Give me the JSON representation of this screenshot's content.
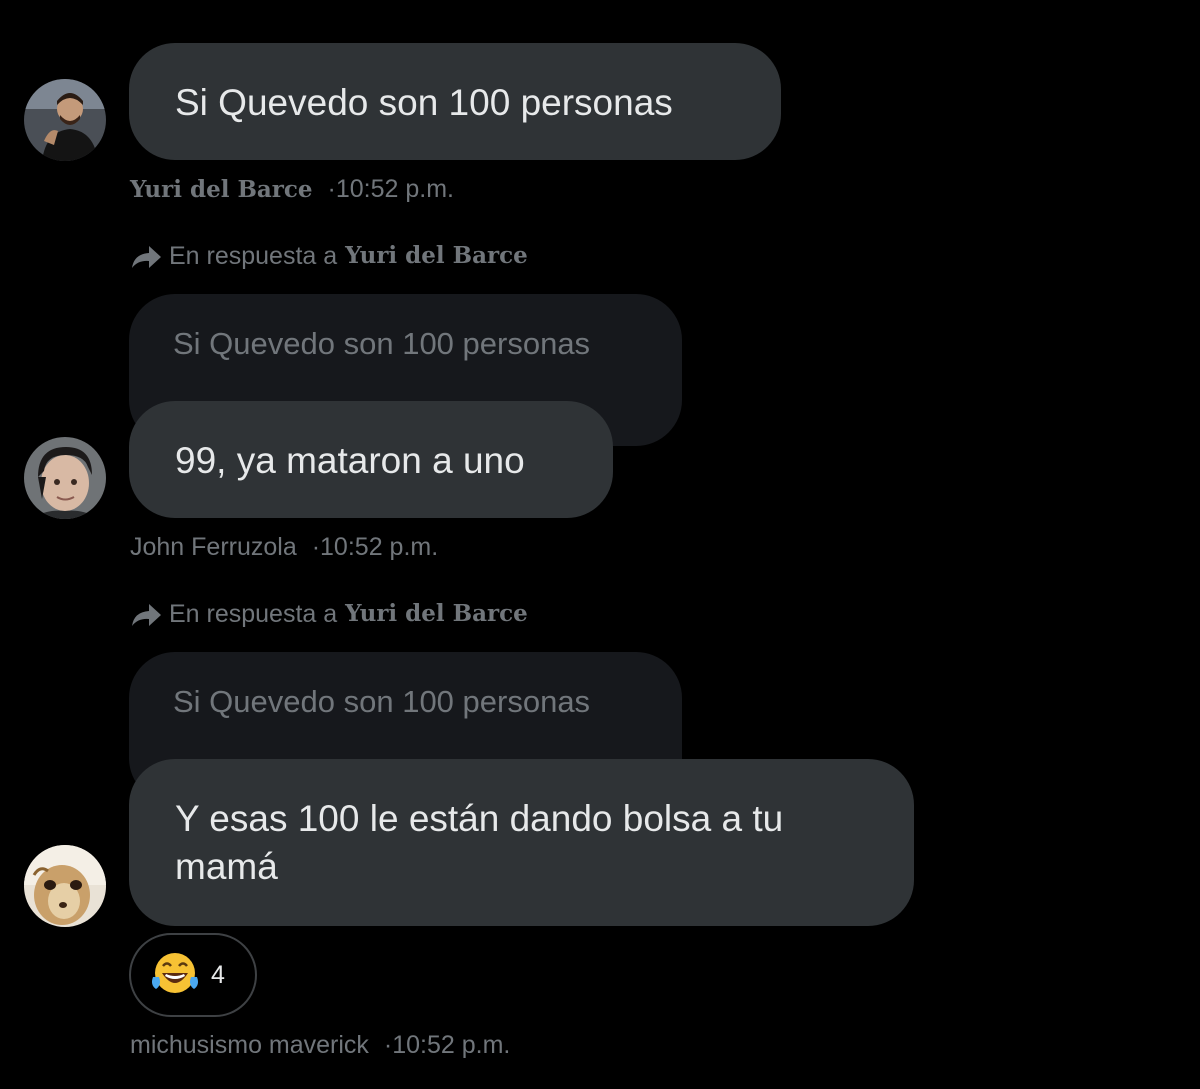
{
  "messages": [
    {
      "text": "Si Quevedo son 100 personas",
      "author": "Yuri del Barce",
      "separator": "·",
      "time": "10:52 p.m.",
      "avatar": "user-photo"
    },
    {
      "reply_prefix": "En respuesta a",
      "reply_to": "Yuri del Barce",
      "quoted_text": "Si Quevedo son 100 personas",
      "text": "99, ya mataron a uno",
      "author": "John Ferruzola",
      "separator": "·",
      "time": "10:52 p.m.",
      "avatar": "user-photo"
    },
    {
      "reply_prefix": "En respuesta a",
      "reply_to": "Yuri del Barce",
      "quoted_text": "Si Quevedo son 100 personas",
      "text_line1": "Y esas 100 le están dando bolsa a tu",
      "text_line2": "mamá",
      "author": "michusismo maverick",
      "separator": "·",
      "time": "10:52 p.m.",
      "avatar": "meerkat-photo",
      "reaction": {
        "emoji": "face-with-tears-of-joy-icon",
        "count": "4"
      }
    }
  ],
  "colors": {
    "background": "#000000",
    "bubble": "#2f3336",
    "quoted_bubble": "#16181c",
    "muted_text": "#71767b",
    "main_text": "#e7e9ea"
  }
}
